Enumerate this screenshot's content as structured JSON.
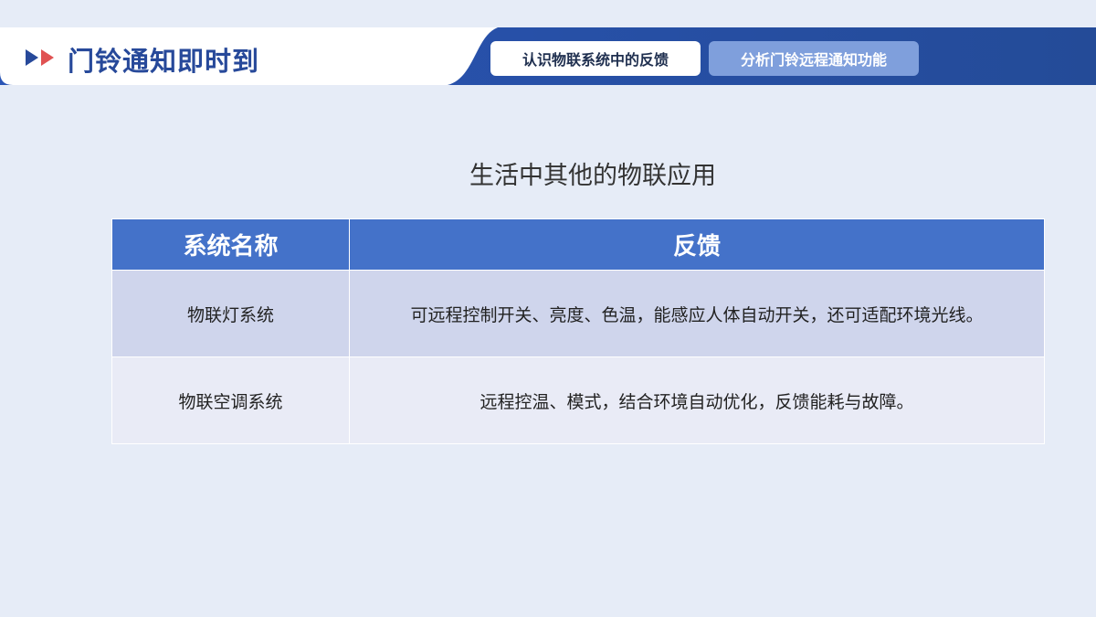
{
  "header": {
    "title": "门铃通知即时到",
    "tabs": [
      {
        "label": "认识物联系统中的反馈",
        "active": true
      },
      {
        "label": "分析门铃远程通知功能",
        "active": false
      }
    ]
  },
  "main": {
    "table_title": "生活中其他的物联应用",
    "columns": [
      "系统名称",
      "反馈"
    ],
    "rows": [
      {
        "name": "物联灯系统",
        "feedback": "可远程控制开关、亮度、色温，能感应人体自动开关，还可适配环境光线。"
      },
      {
        "name": "物联空调系统",
        "feedback": "远程控温、模式，结合环境自动优化，反馈能耗与故障。"
      }
    ]
  },
  "colors": {
    "background": "#e6ecf7",
    "brand_dark": "#27499a",
    "header_blue": "#4472c9",
    "accent_red": "#e05252"
  }
}
